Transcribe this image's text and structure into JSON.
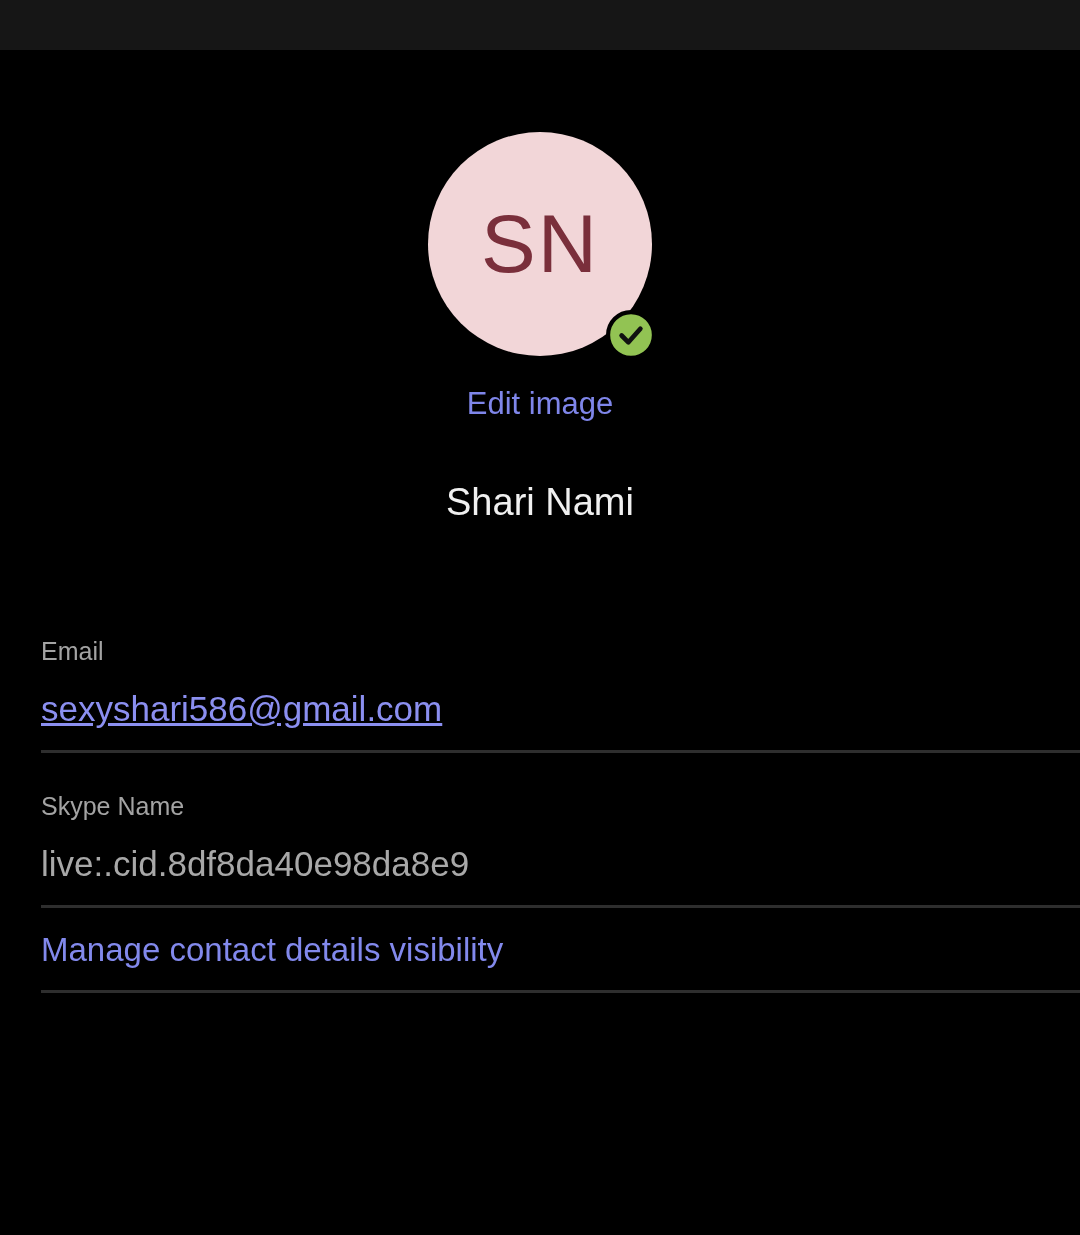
{
  "profile": {
    "initials": "SN",
    "online": true,
    "edit_image": "Edit image",
    "name": "Shari Nami"
  },
  "fields": [
    {
      "label": "Email",
      "value": "sexyshari586@gmail.com",
      "kind": "link"
    },
    {
      "label": "Skype Name",
      "value": "live:.cid.8df8da40e98da8e9",
      "kind": "text"
    }
  ],
  "manage_link": "Manage contact details visibility"
}
